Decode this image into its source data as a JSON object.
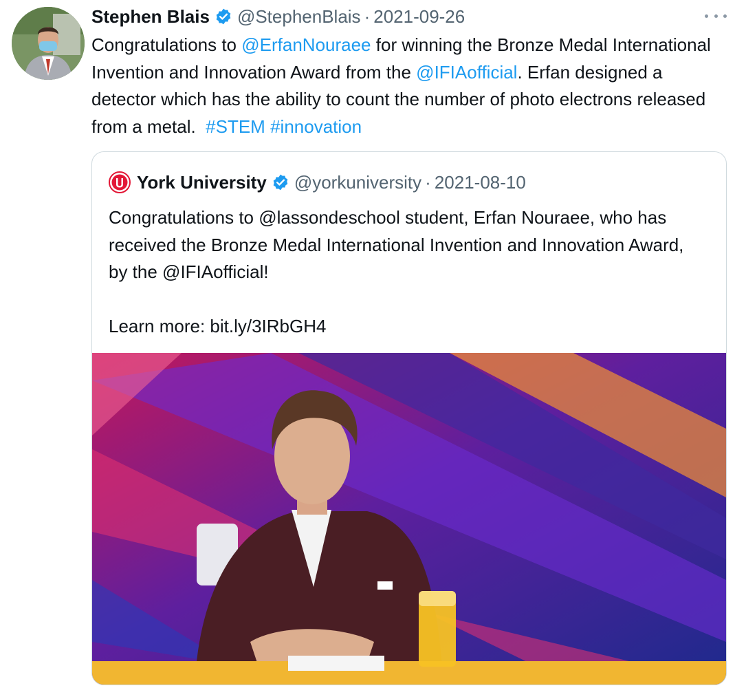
{
  "tweet": {
    "author_name": "Stephen Blais",
    "handle": "@StephenBlais",
    "separator": "·",
    "date": "2021-09-26",
    "text_parts": [
      {
        "text": "Congratulations to ",
        "link": false
      },
      {
        "text": "@ErfanNouraee",
        "link": true
      },
      {
        "text": " for winning the Bronze Medal International Invention and Innovation Award from the ",
        "link": false
      },
      {
        "text": "@IFIAofficial",
        "link": true
      },
      {
        "text": ". Erfan designed a detector which has the ability to count the number of photo electrons released from a metal.  ",
        "link": false
      },
      {
        "text": "#STEM",
        "link": true
      },
      {
        "text": " ",
        "link": false
      },
      {
        "text": "#innovation",
        "link": true
      }
    ]
  },
  "quoted": {
    "author_name": "York University",
    "handle": "@yorkuniversity",
    "separator": "·",
    "date": "2021-08-10",
    "text": "Congratulations to @lassondeschool student, Erfan Nouraee, who has received the Bronze Medal International Invention and Innovation Award, by the @IFIAofficial!\n\nLearn more: bit.ly/3IRbGH4"
  },
  "icons": {
    "verified": "verified-badge-icon",
    "more": "more-options-icon",
    "york_logo": "york-university-logo"
  },
  "colors": {
    "link": "#1d9bf0",
    "muted": "#536471",
    "york_red": "#e31837"
  }
}
